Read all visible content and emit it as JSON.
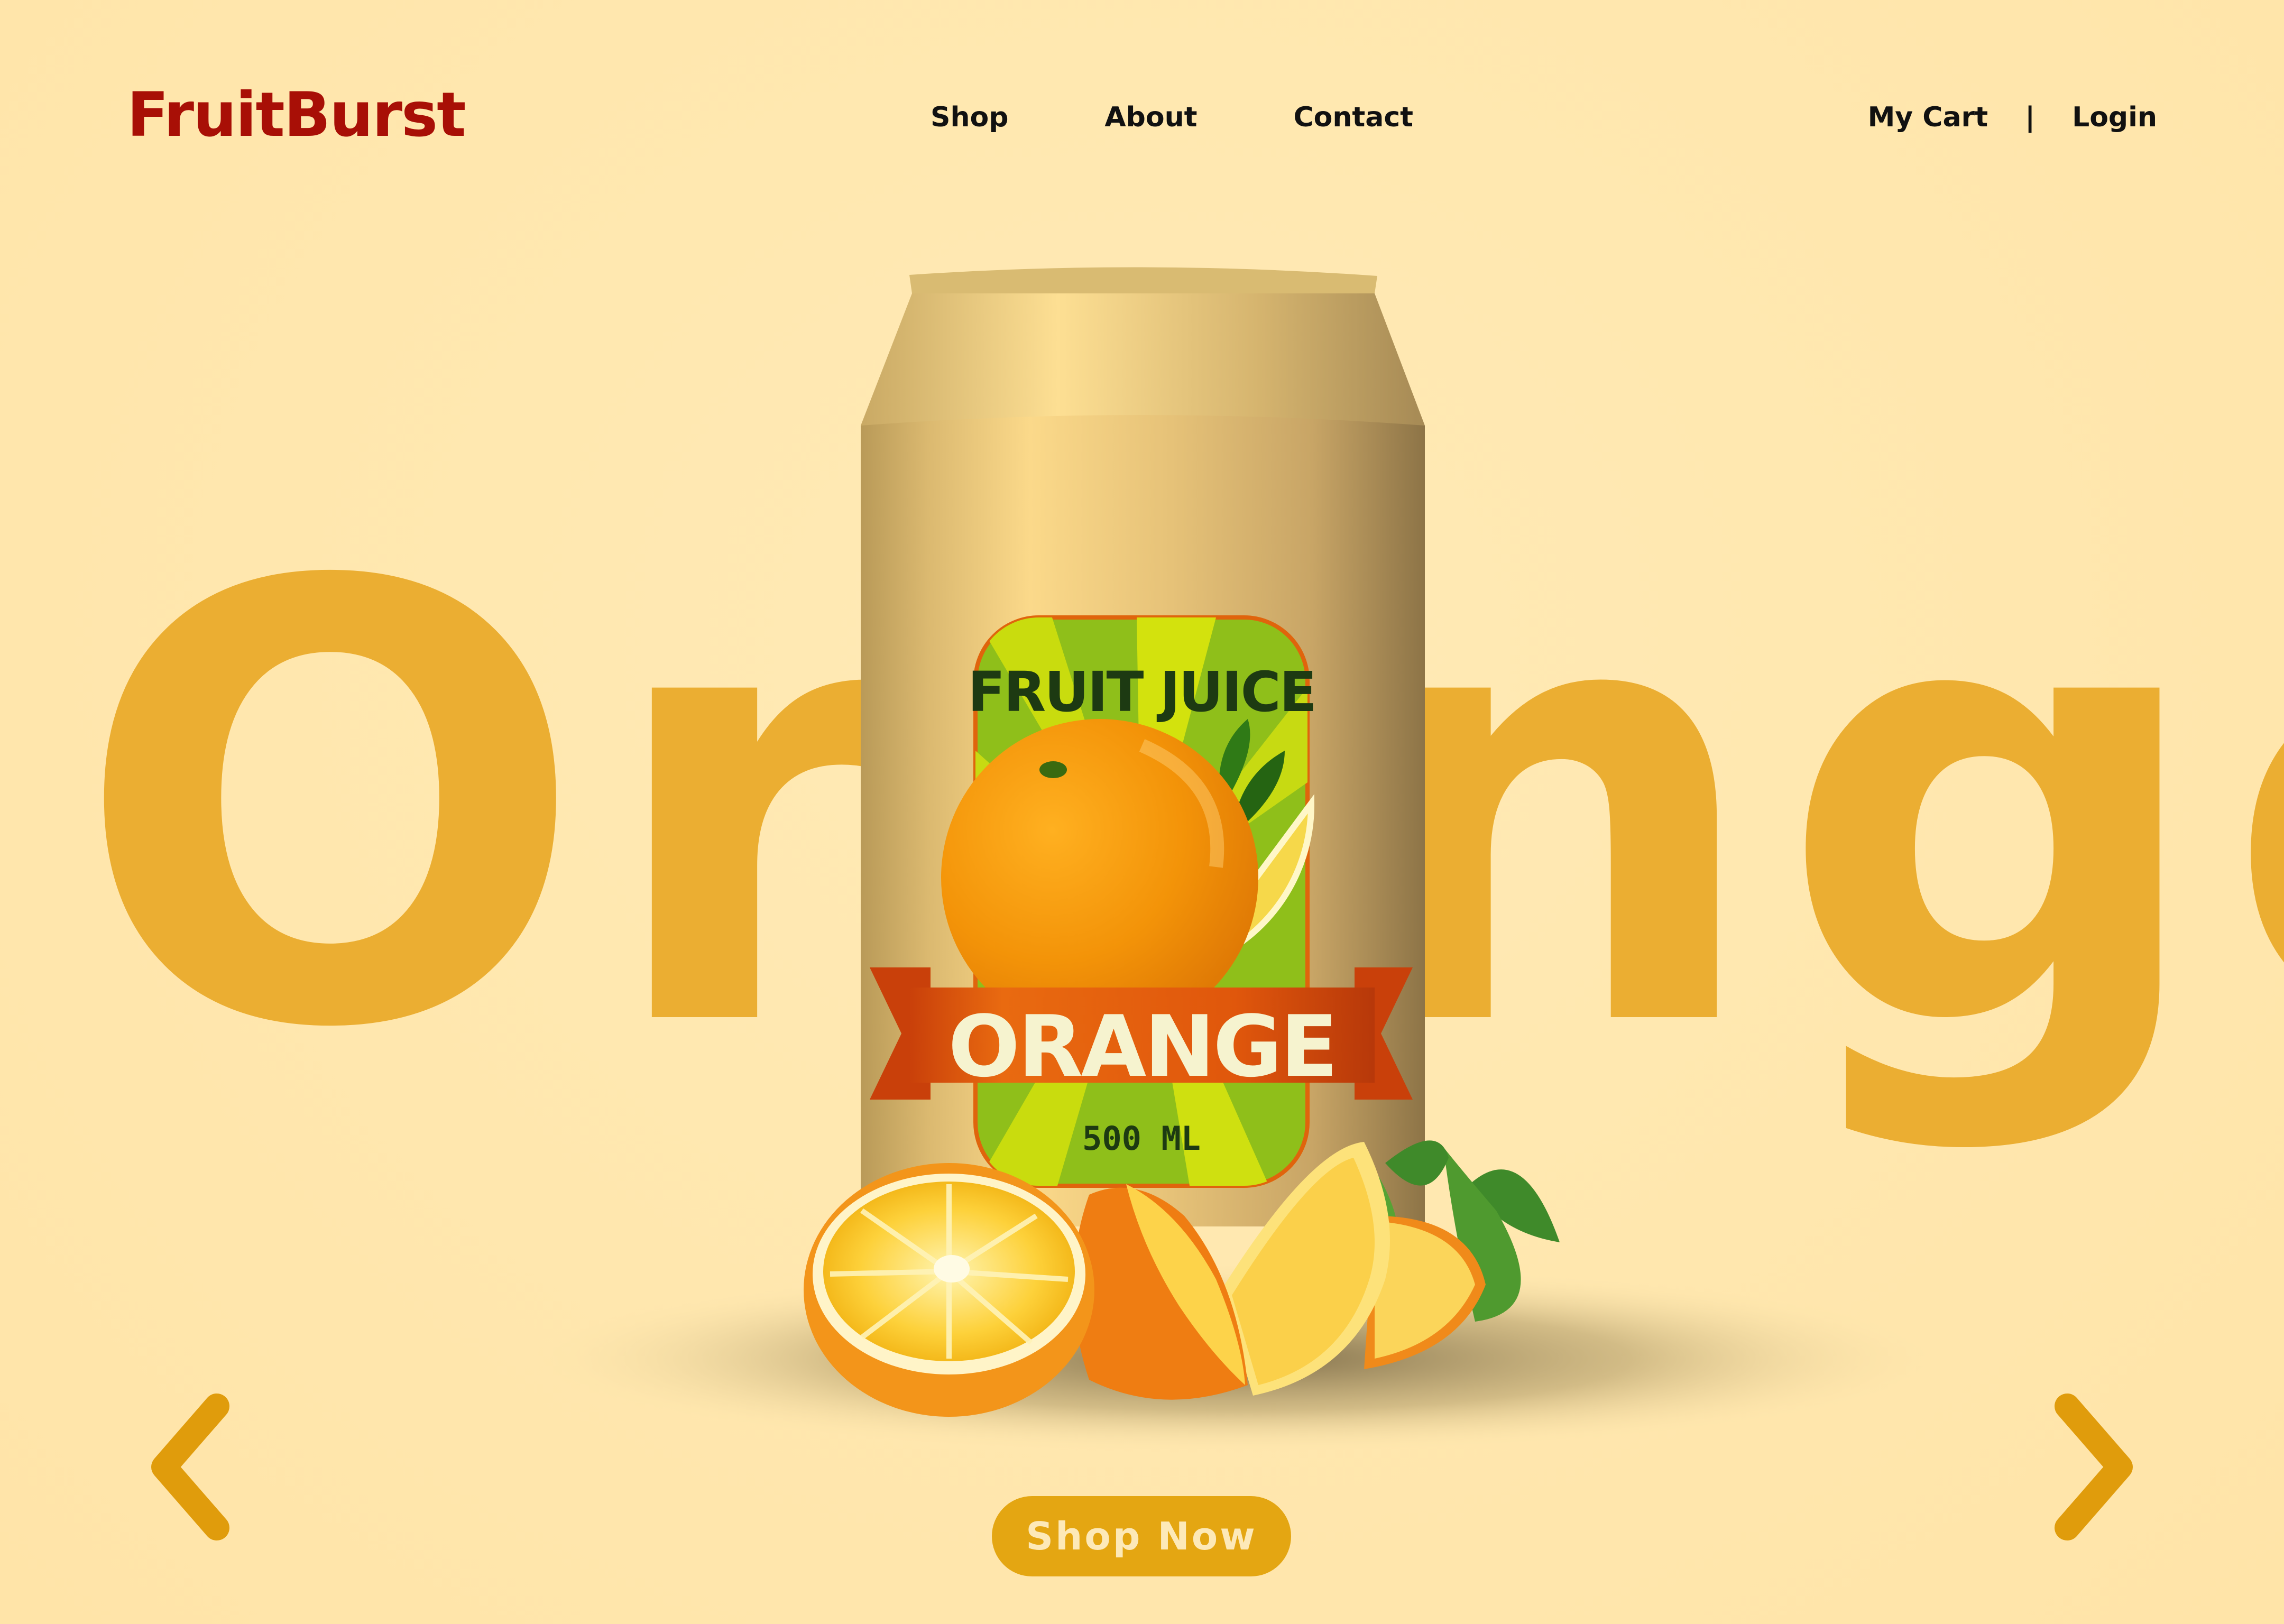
{
  "brand": {
    "name": "FruitBurst"
  },
  "nav": {
    "items": [
      {
        "label": "Shop"
      },
      {
        "label": "About"
      },
      {
        "label": "Contact"
      }
    ]
  },
  "account": {
    "cart_label": "My Cart",
    "separator": "|",
    "login_label": "Login"
  },
  "hero": {
    "background_word": "Orange",
    "product": {
      "label_title": "FRUIT JUICE",
      "label_flavor": "ORANGE",
      "label_volume": "500 ML"
    },
    "prev_icon": "chevron-left-icon",
    "next_icon": "chevron-right-icon",
    "cta_label": "Shop Now"
  },
  "colors": {
    "background": "#ffe7ae",
    "brand": "#a80f06",
    "hero_word": "#ebae32",
    "accent": "#e4a612",
    "cta_text": "#fde9b8",
    "nav_text": "#111111"
  }
}
